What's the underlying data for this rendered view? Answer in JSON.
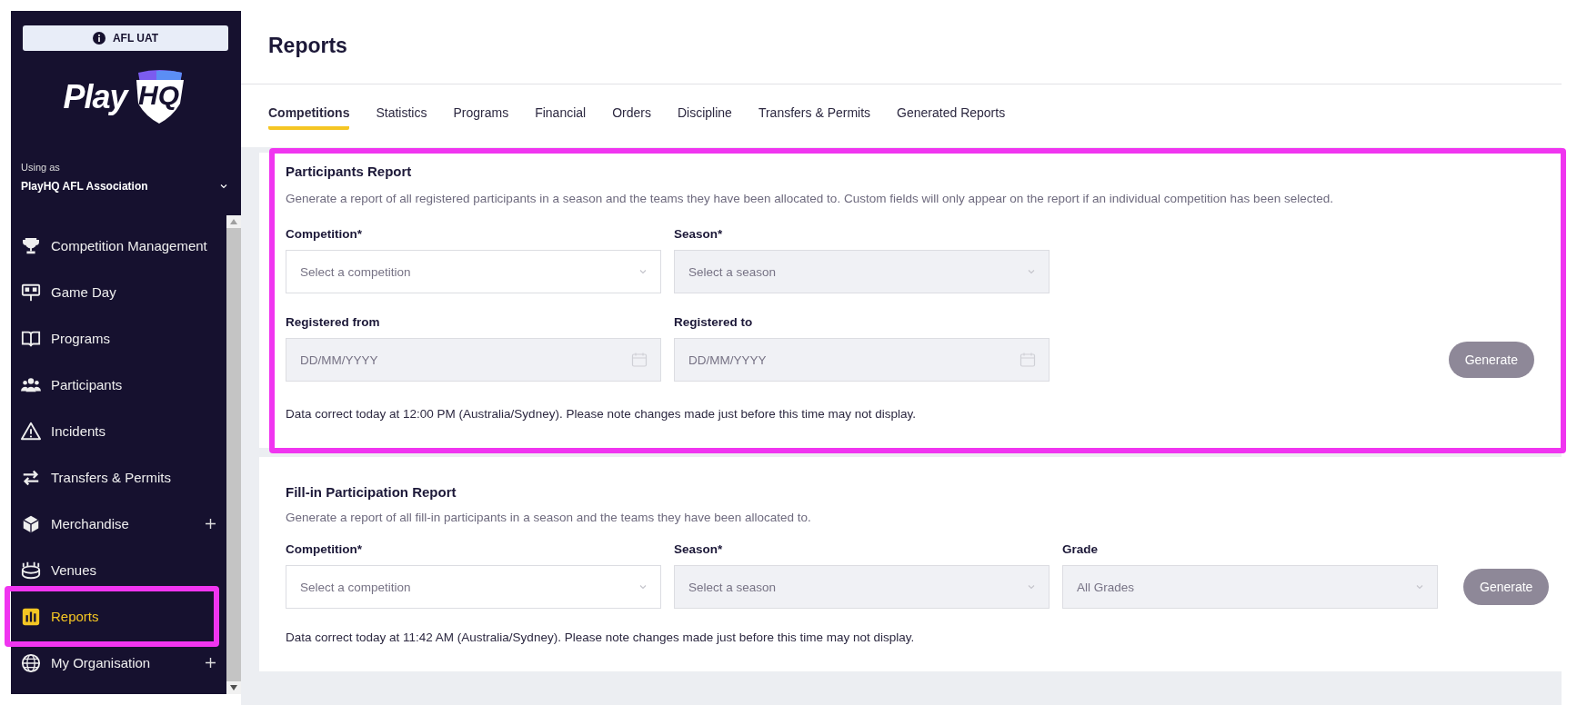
{
  "environment_badge": {
    "label": "AFL UAT"
  },
  "logo": {
    "word": "Play",
    "badge": "HQ"
  },
  "account": {
    "caption": "Using as",
    "name": "PlayHQ AFL Association"
  },
  "nav": [
    {
      "label": "Competition Management",
      "kind": "trophy",
      "expandable": false,
      "selected": false,
      "highlighted": false
    },
    {
      "label": "Game Day",
      "kind": "scoreboard",
      "expandable": false,
      "selected": false,
      "highlighted": false
    },
    {
      "label": "Programs",
      "kind": "book",
      "expandable": false,
      "selected": false,
      "highlighted": false
    },
    {
      "label": "Participants",
      "kind": "people",
      "expandable": false,
      "selected": false,
      "highlighted": false
    },
    {
      "label": "Incidents",
      "kind": "warning",
      "expandable": false,
      "selected": false,
      "highlighted": false
    },
    {
      "label": "Transfers & Permits",
      "kind": "arrows",
      "expandable": false,
      "selected": false,
      "highlighted": false
    },
    {
      "label": "Merchandise",
      "kind": "box",
      "expandable": true,
      "selected": false,
      "highlighted": false
    },
    {
      "label": "Venues",
      "kind": "stadium",
      "expandable": false,
      "selected": false,
      "highlighted": false
    },
    {
      "label": "Reports",
      "kind": "chart",
      "expandable": false,
      "selected": true,
      "highlighted": true
    },
    {
      "label": "My Organisation",
      "kind": "globe",
      "expandable": true,
      "selected": false,
      "highlighted": false
    }
  ],
  "page_title": "Reports",
  "tabs": [
    {
      "label": "Competitions",
      "selected": true
    },
    {
      "label": "Statistics",
      "selected": false
    },
    {
      "label": "Programs",
      "selected": false
    },
    {
      "label": "Financial",
      "selected": false
    },
    {
      "label": "Orders",
      "selected": false
    },
    {
      "label": "Discipline",
      "selected": false
    },
    {
      "label": "Transfers & Permits",
      "selected": false
    },
    {
      "label": "Generated Reports",
      "selected": false
    }
  ],
  "reports": [
    {
      "title": "Participants Report",
      "description": "Generate a report of all registered participants in a season and the teams they have been allocated to. Custom fields will only appear on the report if an individual competition has been selected.",
      "highlighted": true,
      "rows": [
        {
          "fields": [
            {
              "label": "Competition*",
              "kind": "select",
              "placeholder": "Select a competition",
              "disabled": false
            },
            {
              "label": "Season*",
              "kind": "select",
              "placeholder": "Select a season",
              "disabled": true
            }
          ]
        },
        {
          "fields": [
            {
              "label": "Registered from",
              "kind": "date",
              "placeholder": "DD/MM/YYYY",
              "disabled": true
            },
            {
              "label": "Registered to",
              "kind": "date",
              "placeholder": "DD/MM/YYYY",
              "disabled": true
            }
          ]
        }
      ],
      "button": {
        "label": "Generate",
        "disabled": true
      },
      "note": "Data correct today at 12:00 PM (Australia/Sydney). Please note changes made just before this time may not display."
    },
    {
      "title": "Fill-in Participation Report",
      "description": "Generate a report of all fill-in participants in a season and the teams they have been allocated to.",
      "highlighted": false,
      "rows": [
        {
          "fields": [
            {
              "label": "Competition*",
              "kind": "select",
              "placeholder": "Select a competition",
              "disabled": false
            },
            {
              "label": "Season*",
              "kind": "select",
              "placeholder": "Select a season",
              "disabled": true
            },
            {
              "label": "Grade",
              "kind": "select",
              "value": "All Grades",
              "disabled": true
            }
          ]
        }
      ],
      "button": {
        "label": "Generate",
        "disabled": true
      },
      "note": "Data correct today at 11:42 AM (Australia/Sydney). Please note changes made just before this time may not display."
    }
  ]
}
